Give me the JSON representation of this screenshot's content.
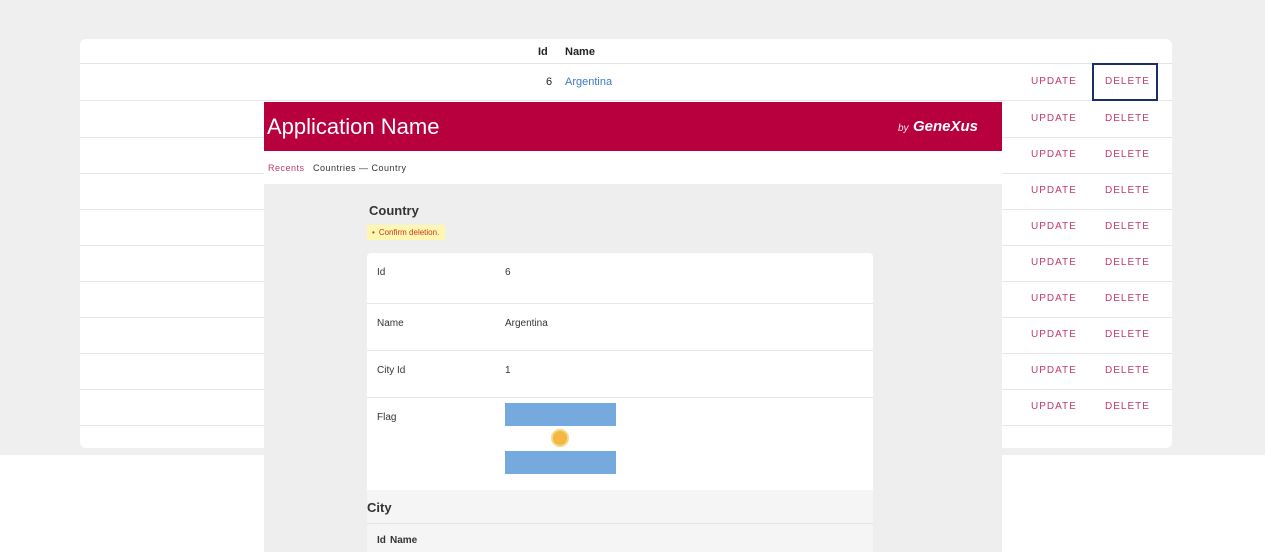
{
  "list": {
    "columns": {
      "id": "Id",
      "name": "Name"
    },
    "first_row": {
      "id": "6",
      "name": "Argentina"
    },
    "actions": {
      "update": "UPDATE",
      "delete": "DELETE"
    },
    "row_count": 10
  },
  "app": {
    "title": "Application Name",
    "brand_by": "by",
    "brand_name": "GeneXus",
    "breadcrumb": {
      "recents": "Recents",
      "path": "Countries — Country"
    },
    "form_title": "Country",
    "message": "Confirm deletion.",
    "fields": [
      {
        "label": "Id",
        "value": "6"
      },
      {
        "label": "Name",
        "value": "Argentina"
      },
      {
        "label": "City Id",
        "value": "1"
      },
      {
        "label": "Flag",
        "value": ""
      }
    ],
    "city_section": {
      "title": "City",
      "columns": {
        "id": "Id",
        "name": "Name"
      }
    }
  },
  "colors": {
    "header": "#b8003f",
    "action": "#c23a67",
    "link": "#3d7bc4",
    "focus": "#1c2d6b"
  }
}
